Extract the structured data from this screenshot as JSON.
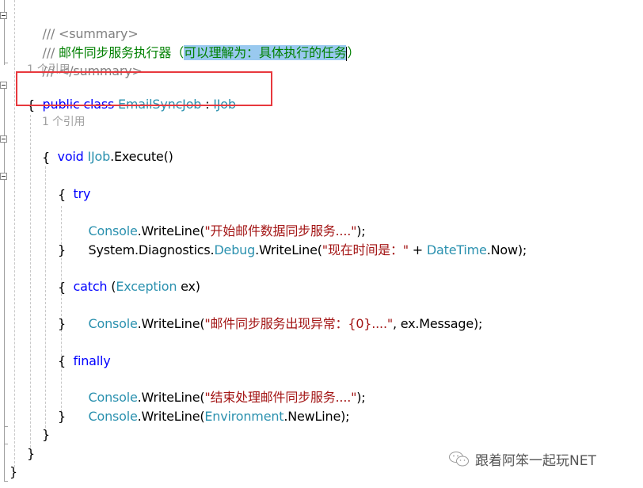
{
  "code": {
    "lines": {
      "l1": {
        "comment_prefix": "/// ",
        "text": "<summary>"
      },
      "l2": {
        "comment_prefix": "/// ",
        "text": "邮件同步服务执行器（",
        "selected": "可以理解为：具体执行的任务",
        "tail": "）"
      },
      "l3": {
        "comment_prefix": "/// ",
        "text": "</summary>"
      },
      "l4": {
        "refs": "1 个引用"
      },
      "l5": {
        "kw1": "public",
        "kw2": "class",
        "type": "EmailSyncJob",
        "sep": " : ",
        "iface": "IJob"
      },
      "l6": {
        "text": "{"
      },
      "l7": {
        "refs": "1 个引用"
      },
      "l8": {
        "kw": "void",
        "iface": "IJob",
        "rest": ".Execute()"
      },
      "l9": {
        "text": "{"
      },
      "l10": {
        "kw": "try"
      },
      "l11": {
        "text": "{"
      },
      "l12": {
        "type": "Console",
        "call": ".WriteLine(",
        "str": "\"开始邮件数据同步服务....\"",
        "end": ");"
      },
      "l13": {
        "ns": "System.Diagnostics.",
        "type": "Debug",
        "call": ".WriteLine(",
        "str": "\"现在时间是：\"",
        "plus": " + ",
        "type2": "DateTime",
        "end": ".Now);"
      },
      "l14": {
        "text": "}"
      },
      "l15": {
        "kw": "catch",
        "open": " (",
        "type": "Exception",
        "rest": " ex)"
      },
      "l16": {
        "text": "{"
      },
      "l17": {
        "type": "Console",
        "call": ".WriteLine(",
        "str": "\"邮件同步服务出现异常：{0}....\"",
        "end": ", ex.Message);"
      },
      "l18": {
        "text": "}"
      },
      "l19": {
        "kw": "finally"
      },
      "l20": {
        "text": "{"
      },
      "l21": {
        "type": "Console",
        "call": ".WriteLine(",
        "str": "\"结束处理邮件同步服务....\"",
        "end": ");"
      },
      "l22": {
        "type": "Console",
        "call": ".WriteLine(",
        "type2": "Environment",
        "end": ".NewLine);"
      },
      "l23": {
        "text": "}"
      },
      "l24": {
        "text": "}"
      },
      "l25": {
        "text": "}"
      },
      "l26": {
        "text": "}"
      }
    }
  },
  "colors": {
    "keyword": "#0000ff",
    "type": "#2b91af",
    "string": "#a31515",
    "comment": "#008000",
    "highlight_box": "#e8383d",
    "selection": "#99c9ef"
  },
  "watermark": {
    "text": "跟着阿笨一起玩NET",
    "icon": "wechat-icon"
  }
}
